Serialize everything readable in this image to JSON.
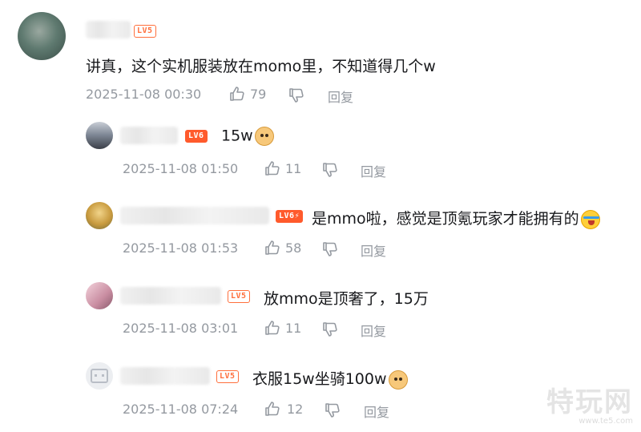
{
  "comments": [
    {
      "level": "LV5",
      "text": "讲真，这个实机服装放在momo里，不知道得几个w",
      "time": "2025-11-08 00:30",
      "likes": "79",
      "reply_label": "回复"
    },
    {
      "level": "LV6",
      "text": "15w",
      "emoji": "dog-emoji",
      "time": "2025-11-08 01:50",
      "likes": "11",
      "reply_label": "回复"
    },
    {
      "level": "LV6",
      "text": "是mmo啦，感觉是顶氪玩家才能拥有的",
      "emoji": "crying-emoji",
      "time": "2025-11-08 01:53",
      "likes": "58",
      "reply_label": "回复"
    },
    {
      "level": "LV5",
      "text": "放mmo是顶奢了，15万",
      "time": "2025-11-08 03:01",
      "likes": "11",
      "reply_label": "回复"
    },
    {
      "level": "LV5",
      "text": "衣服15w坐骑100w",
      "emoji": "dog-emoji",
      "time": "2025-11-08 07:24",
      "likes": "12",
      "reply_label": "回复"
    }
  ],
  "watermark": {
    "main": "特玩网",
    "sub": "www.te5.com"
  },
  "colors": {
    "level_badge": "#ff6f3c",
    "meta_text": "#9499a0"
  }
}
